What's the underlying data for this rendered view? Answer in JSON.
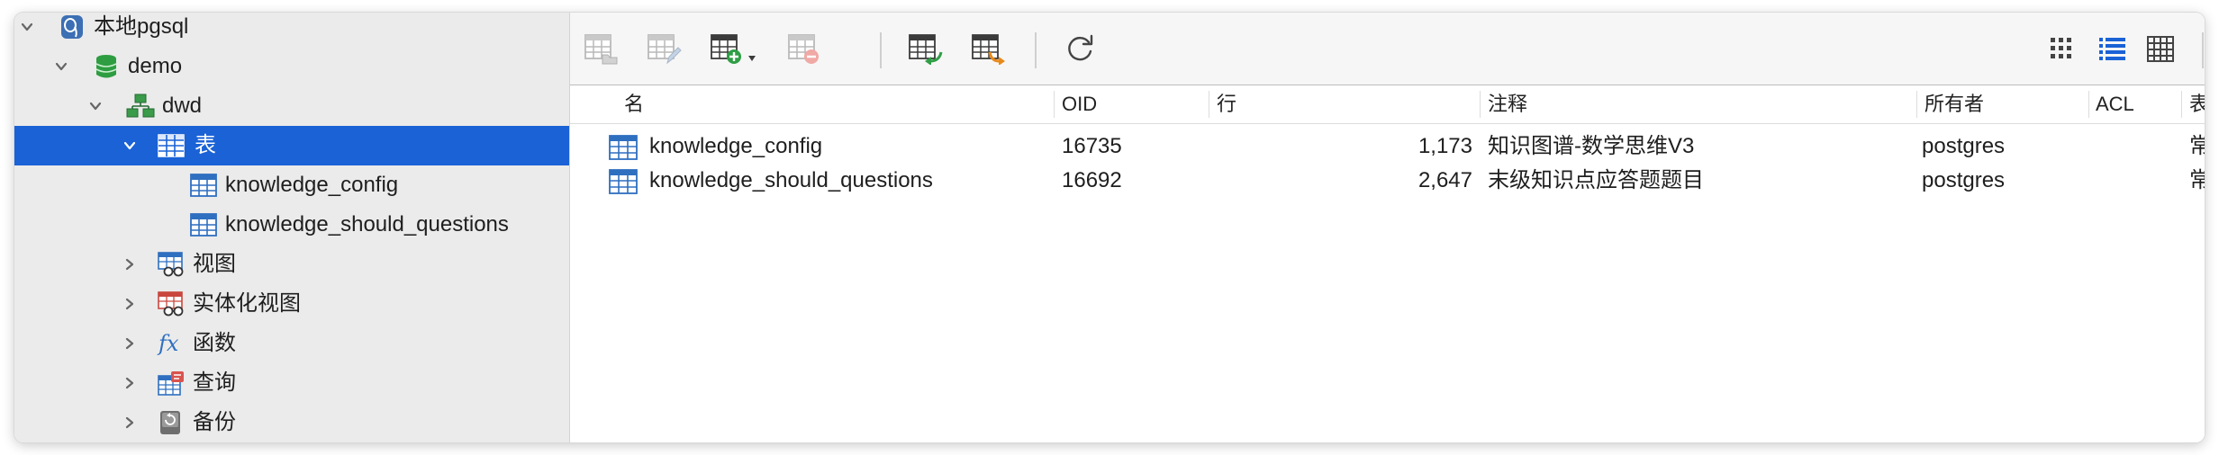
{
  "sidebar": {
    "connection_label": "本地pgsql",
    "database_label": "demo",
    "schema_label": "dwd",
    "tables_group_label": "表",
    "tables": [
      "knowledge_config",
      "knowledge_should_questions"
    ],
    "groups": {
      "views": "视图",
      "materialized_views": "实体化视图",
      "functions": "函数",
      "queries": "查询",
      "backups": "备份"
    }
  },
  "toolbar": {
    "buttons": [
      "open-table-icon",
      "design-table-icon",
      "new-table-icon",
      "delete-table-icon",
      "import-wizard-icon",
      "export-wizard-icon",
      "refresh-icon"
    ],
    "view_modes": [
      "grid-view-icon",
      "list-view-icon",
      "detail-view-icon"
    ],
    "active_view_mode": "list-view-icon"
  },
  "table_list": {
    "columns": {
      "name": "名",
      "oid": "OID",
      "rows": "行",
      "comment": "注释",
      "owner": "所有者",
      "acl": "ACL",
      "tablespace": "表空"
    },
    "rows": [
      {
        "name": "knowledge_config",
        "oid": "16735",
        "rows": "1,173",
        "comment": "知识图谱-数学思维V3",
        "owner": "postgres",
        "acl": "",
        "tablespace": "常规"
      },
      {
        "name": "knowledge_should_questions",
        "oid": "16692",
        "rows": "2,647",
        "comment": "末级知识点应答题题目",
        "owner": "postgres",
        "acl": "",
        "tablespace": "常规"
      }
    ]
  },
  "colors": {
    "selection": "#1a62d6",
    "sidebar_bg": "#ebebeb",
    "toolbar_bg": "#f6f6f6",
    "table_icon": "#2f6fc0",
    "database_icon": "#2e9d41",
    "schema_icon": "#3a9b4a",
    "connection_icon": "#3c6fb4"
  }
}
